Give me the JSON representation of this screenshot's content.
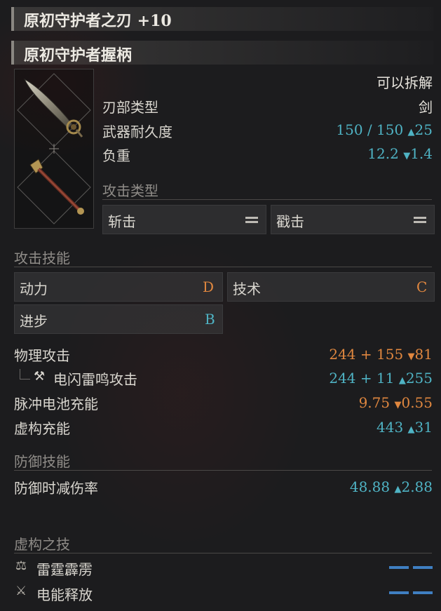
{
  "weapon": {
    "title": "原初守护者之刃 +10",
    "handle_name": "原初守护者握柄",
    "dismantle": "可以拆解"
  },
  "stats": {
    "blade_type_label": "刃部类型",
    "blade_type_value": "剑",
    "durability_label": "武器耐久度",
    "durability_value": "150 / 150",
    "durability_delta": "25",
    "weight_label": "负重",
    "weight_value": "12.2",
    "weight_delta": "1.4"
  },
  "attack_type": {
    "header": "攻击类型",
    "slash": "斩击",
    "pierce": "戳击"
  },
  "attack_skill": {
    "header": "攻击技能",
    "power_label": "动力",
    "power_grade": "D",
    "technique_label": "技术",
    "technique_grade": "C",
    "advance_label": "进步",
    "advance_grade": "B"
  },
  "attack": {
    "physical_label": "物理攻击",
    "physical_value": "244 + 155",
    "physical_delta": "81",
    "thunder_label": "电闪雷鸣攻击",
    "thunder_value": "244 + 11",
    "thunder_delta": "255",
    "pulse_label": "脉冲电池充能",
    "pulse_value": "9.75",
    "pulse_delta": "0.55",
    "fable_label": "虚构充能",
    "fable_value": "443",
    "fable_delta": "31"
  },
  "defense": {
    "header": "防御技能",
    "reduction_label": "防御时减伤率",
    "reduction_value": "48.88",
    "reduction_delta": "2.88"
  },
  "fable_arts": {
    "header": "虚构之技",
    "art1": "雷霆霹雳",
    "art2": "电能释放"
  },
  "colors": {
    "increase": "#4fb3c4",
    "decrease": "#e0873f",
    "dash": "#3f7fc2"
  }
}
